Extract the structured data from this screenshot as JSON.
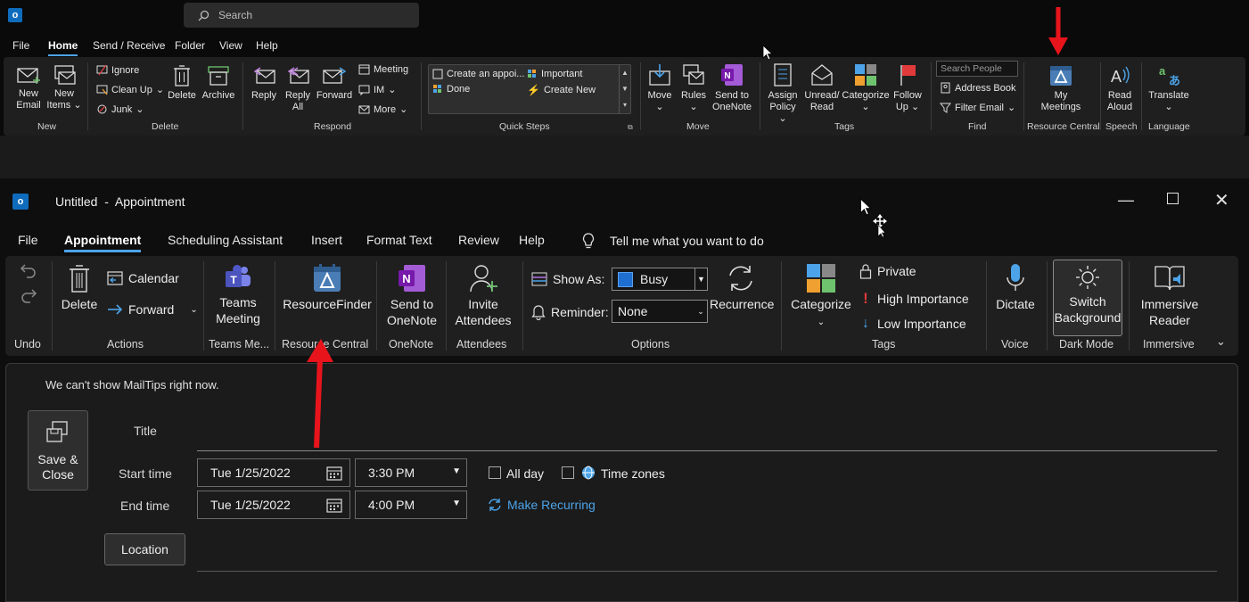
{
  "main": {
    "search_placeholder": "Search",
    "menu_tabs": [
      "File",
      "Home",
      "Send / Receive",
      "Folder",
      "View",
      "Help"
    ],
    "ribbon": {
      "new_email": "New Email",
      "new_email_l1": "New",
      "new_email_l2": "Email",
      "new_items_l1": "New",
      "new_items_l2": "Items",
      "ignore": "Ignore",
      "clean_up": "Clean Up",
      "junk": "Junk",
      "delete": "Delete",
      "archive": "Archive",
      "reply": "Reply",
      "reply_all_l1": "Reply",
      "reply_all_l2": "All",
      "forward": "Forward",
      "meeting": "Meeting",
      "im": "IM",
      "more": "More",
      "qs_create": "Create an appoi...",
      "qs_done": "Done",
      "qs_important": "Important",
      "qs_create_new": "Create New",
      "move": "Move",
      "rules": "Rules",
      "send_onenote_l1": "Send to",
      "send_onenote_l2": "OneNote",
      "assign_policy_l1": "Assign",
      "assign_policy_l2": "Policy",
      "unread_l1": "Unread/",
      "unread_l2": "Read",
      "categorize": "Categorize",
      "follow_up_l1": "Follow",
      "follow_up_l2": "Up",
      "search_people": "Search People",
      "address_book": "Address Book",
      "filter_email": "Filter Email",
      "my_meetings_l1": "My",
      "my_meetings_l2": "Meetings",
      "read_aloud_l1": "Read",
      "read_aloud_l2": "Aloud",
      "translate": "Translate"
    },
    "groups": {
      "new": "New",
      "delete": "Delete",
      "respond": "Respond",
      "quick_steps": "Quick Steps",
      "move": "Move",
      "tags": "Tags",
      "find": "Find",
      "resource_central": "Resource Central",
      "speech": "Speech",
      "language": "Language"
    }
  },
  "appointment": {
    "title": "Untitled  -  Appointment",
    "tabs": [
      "File",
      "Appointment",
      "Scheduling Assistant",
      "Insert",
      "Format Text",
      "Review",
      "Help"
    ],
    "tell_me": "Tell me what you want to do",
    "ribbon": {
      "delete": "Delete",
      "calendar": "Calendar",
      "forward": "Forward",
      "teams_l1": "Teams",
      "teams_l2": "Meeting",
      "resource_finder": "ResourceFinder",
      "send_onenote_l1": "Send to",
      "send_onenote_l2": "OneNote",
      "invite_l1": "Invite",
      "invite_l2": "Attendees",
      "show_as_label": "Show As:",
      "show_as_value": "Busy",
      "reminder_label": "Reminder:",
      "reminder_value": "None",
      "recurrence": "Recurrence",
      "categorize": "Categorize",
      "private": "Private",
      "high_importance": "High Importance",
      "low_importance": "Low Importance",
      "dictate": "Dictate",
      "switch_bg_l1": "Switch",
      "switch_bg_l2": "Background",
      "immersive_l1": "Immersive",
      "immersive_l2": "Reader"
    },
    "groups": {
      "undo": "Undo",
      "actions": "Actions",
      "teams": "Teams Me...",
      "resource_central": "Resource Central",
      "onenote": "OneNote",
      "attendees": "Attendees",
      "options": "Options",
      "tags": "Tags",
      "voice": "Voice",
      "dark_mode": "Dark Mode",
      "immersive": "Immersive"
    },
    "form": {
      "mailtips": "We can't show MailTips right now.",
      "save_close_l1": "Save &",
      "save_close_l2": "Close",
      "title_label": "Title",
      "start_label": "Start time",
      "end_label": "End time",
      "start_date": "Tue 1/25/2022",
      "start_time": "3:30 PM",
      "end_date": "Tue 1/25/2022",
      "end_time": "4:00 PM",
      "all_day": "All day",
      "time_zones": "Time zones",
      "make_recurring": "Make Recurring",
      "location": "Location"
    }
  },
  "colors": {
    "accent_blue": "#4ca3e8",
    "annotation_red": "#e8141c",
    "importance_red": "#e03a3a",
    "low_importance_blue": "#4ca3e8"
  }
}
